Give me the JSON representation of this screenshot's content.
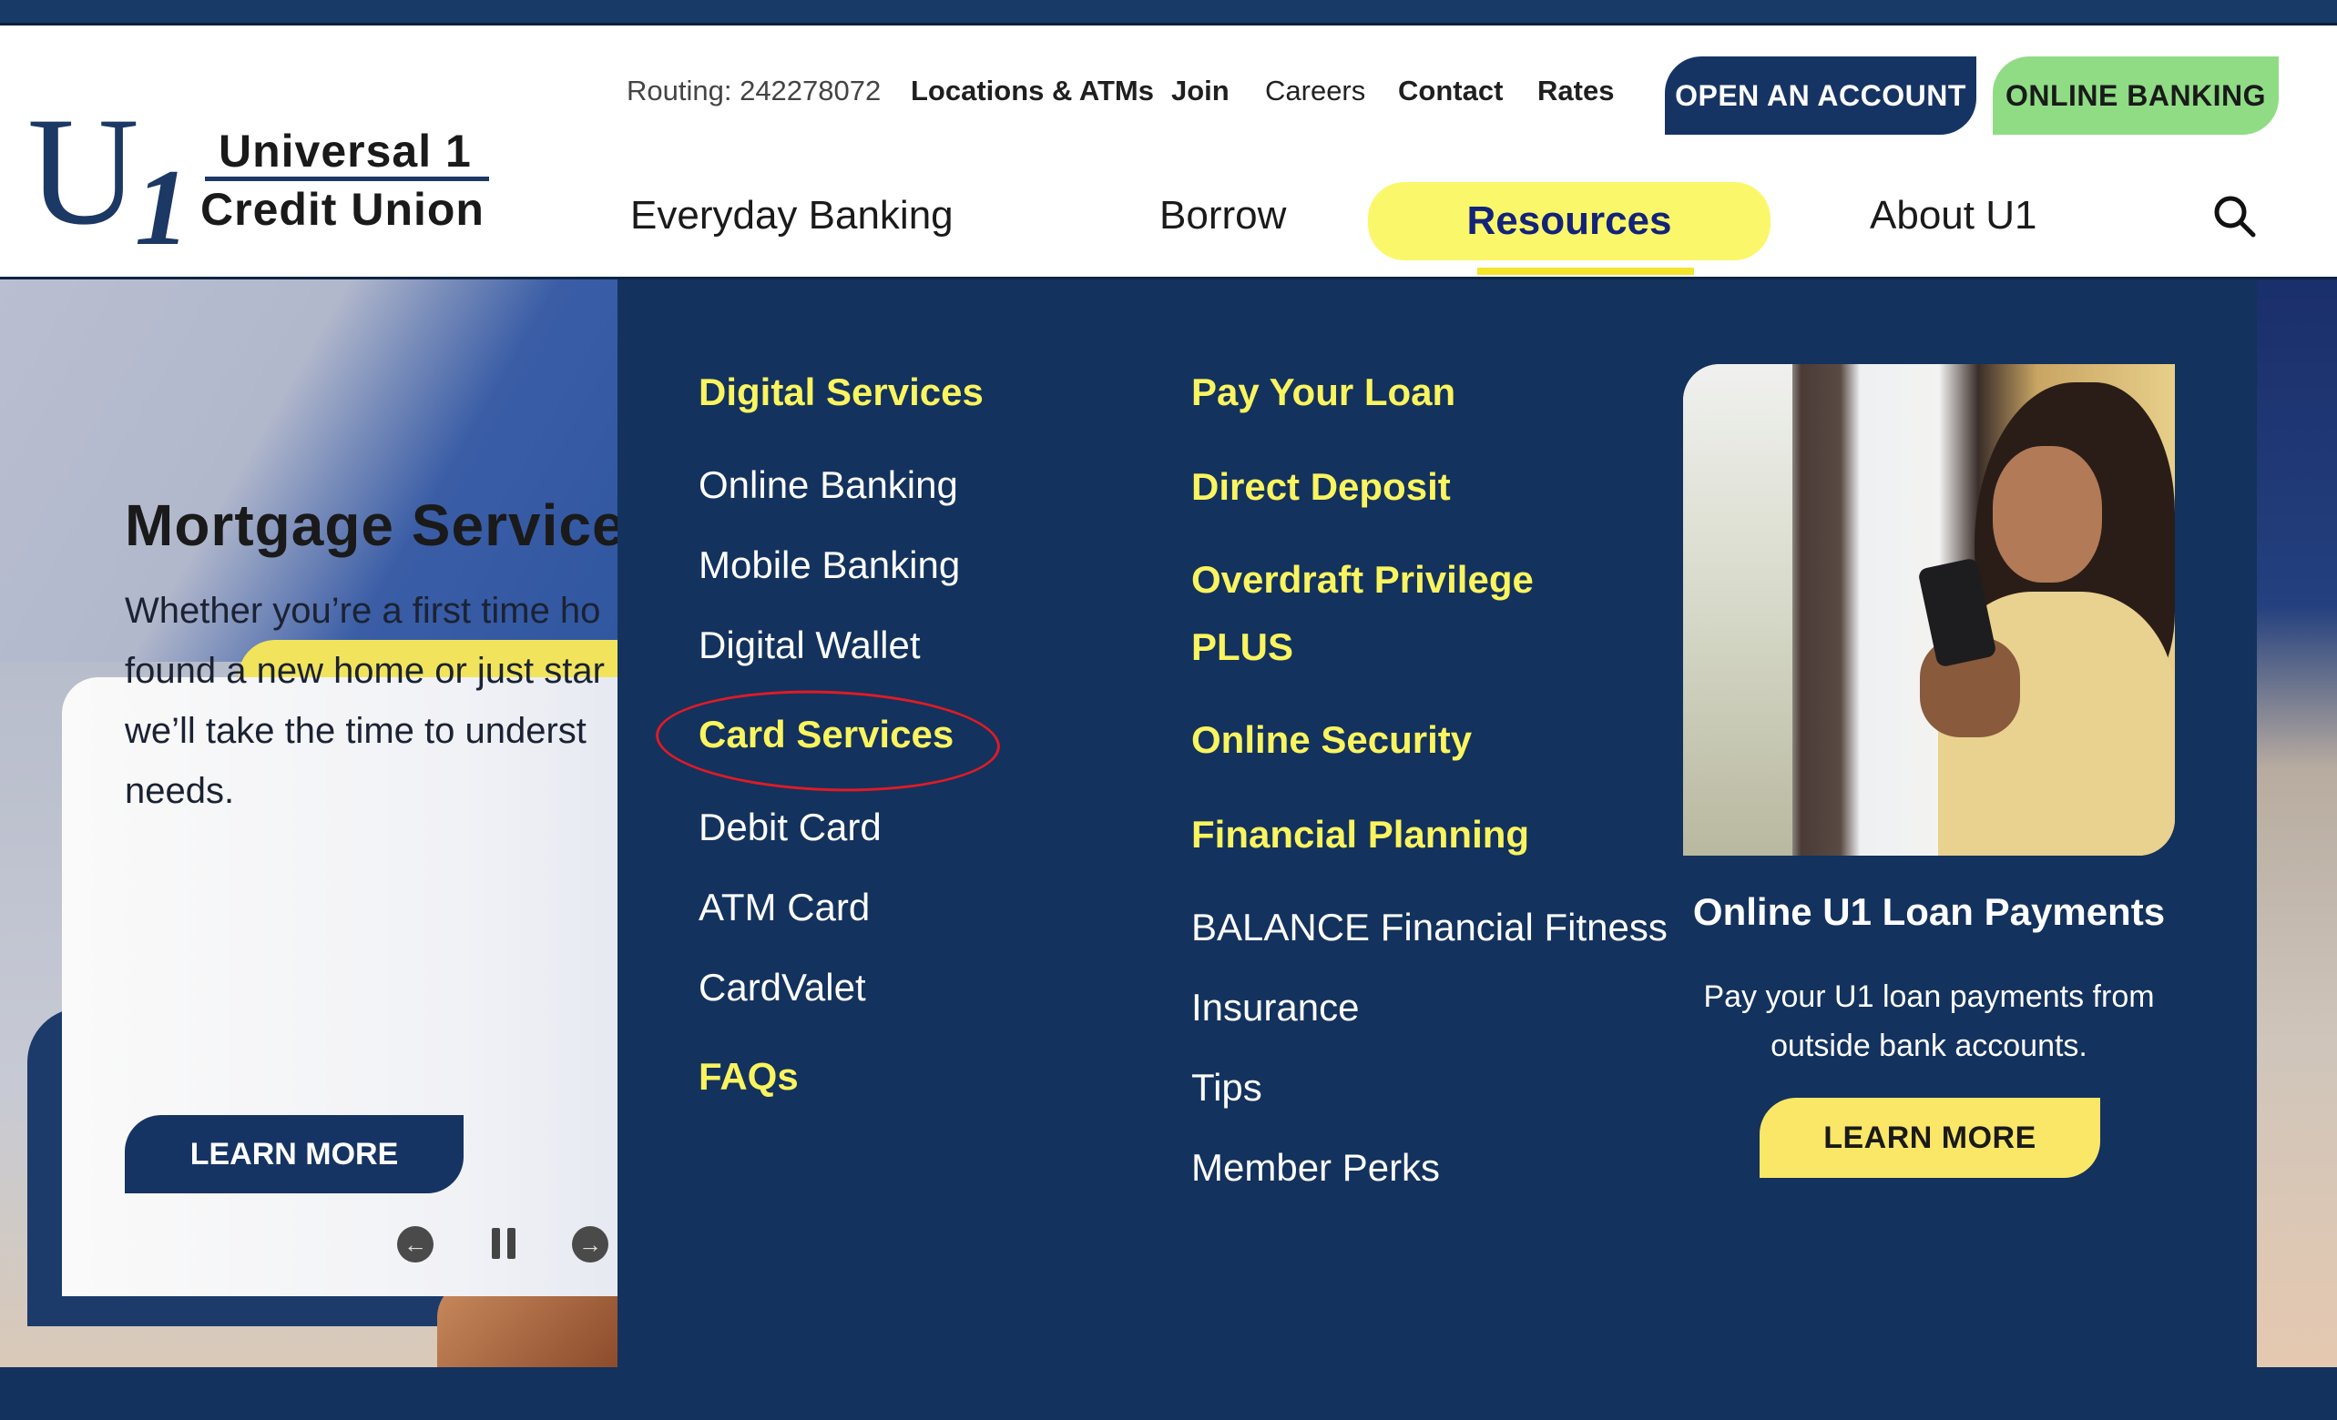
{
  "brand": {
    "logo_mark": "U",
    "logo_sub": "1",
    "name_line1": "Universal 1",
    "name_line2": "Credit Union"
  },
  "utility_nav": {
    "routing": "Routing: 242278072",
    "links": [
      "Locations & ATMs",
      "Join",
      "Careers",
      "Contact",
      "Rates"
    ]
  },
  "header_buttons": {
    "open_account": "OPEN AN ACCOUNT",
    "online_banking": "ONLINE BANKING"
  },
  "main_nav": {
    "items": [
      "Everyday Banking",
      "Borrow",
      "Resources",
      "About U1"
    ],
    "active": "Resources",
    "search_icon": "search-icon"
  },
  "hero": {
    "title": "Mortgage Services",
    "text": "Whether you’re a first time home buyer, found a new home or just starting to refinance, we’ll take the time to understand your needs.",
    "visible_lines": [
      "Whether you’re a first time ho",
      "found a new home or just star",
      "we’ll take the time to underst",
      "needs."
    ],
    "button": "LEARN MORE",
    "controls": {
      "prev_icon": "arrow-left-circle-icon",
      "pause_icon": "pause-icon",
      "next_icon": "arrow-right-circle-icon",
      "prev_glyph": "←",
      "next_glyph": "→"
    }
  },
  "mega_menu": {
    "column1": [
      {
        "label": "Digital Services",
        "type": "heading"
      },
      {
        "label": "Online Banking",
        "type": "link"
      },
      {
        "label": "Mobile Banking",
        "type": "link"
      },
      {
        "label": "Digital Wallet",
        "type": "link"
      },
      {
        "label": "Card Services",
        "type": "heading",
        "annotated": true
      },
      {
        "label": "Debit Card",
        "type": "link"
      },
      {
        "label": "ATM Card",
        "type": "link"
      },
      {
        "label": "CardValet",
        "type": "link"
      },
      {
        "label": "FAQs",
        "type": "heading"
      }
    ],
    "column2": [
      {
        "label": "Pay Your Loan",
        "type": "heading"
      },
      {
        "label": "Direct Deposit",
        "type": "heading"
      },
      {
        "label": "Overdraft Privilege",
        "type": "heading"
      },
      {
        "label": "PLUS",
        "type": "heading"
      },
      {
        "label": "Online Security",
        "type": "heading"
      },
      {
        "label": "Financial Planning",
        "type": "heading"
      },
      {
        "label": "BALANCE Financial Fitness",
        "type": "link"
      },
      {
        "label": "Insurance",
        "type": "link"
      },
      {
        "label": "Tips",
        "type": "link"
      },
      {
        "label": "Member Perks",
        "type": "link"
      }
    ],
    "promo": {
      "image_alt": "Woman smiling at smartphone by a window",
      "title": "Online U1 Loan Payments",
      "text_line1": "Pay your U1 loan payments from",
      "text_line2": "outside bank accounts.",
      "button": "LEARN MORE"
    }
  },
  "colors": {
    "navy": "#13325e",
    "button_navy": "#163463",
    "accent_yellow": "#faf45e",
    "green_button": "#8fdc85",
    "annotation_red": "#e01b24"
  }
}
